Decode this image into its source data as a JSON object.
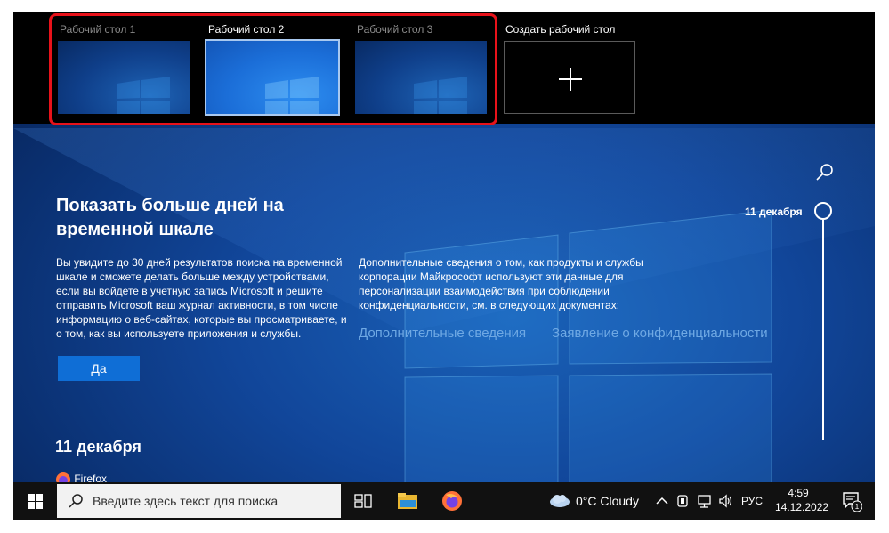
{
  "desktops": [
    {
      "label": "Рабочий стол 1",
      "active": false
    },
    {
      "label": "Рабочий стол 2",
      "active": true
    },
    {
      "label": "Рабочий стол 3",
      "active": false
    }
  ],
  "new_desktop": {
    "label": "Создать рабочий стол",
    "icon": "plus-icon"
  },
  "highlight_color": "#e8121a",
  "timeline": {
    "heading": "Показать больше дней на временной шкале",
    "description": "Вы увидите до 30 дней результатов поиска на временной шкале и сможете делать больше между устройствами, если вы войдете в учетную запись Microsoft и решите отправить Microsoft ваш журнал активности, в том числе информацию о веб-сайтах, которые вы просматриваете, и о том, как вы используете приложения и службы.",
    "privacy_text": "Дополнительные сведения о том, как продукты и службы корпорации Майкрософт используют эти данные для персонализации взаимодействия при соблюдении конфиденциальности, см. в следующих документах:",
    "link_more": "Дополнительные сведения",
    "link_privacy": "Заявление о конфиденциальности",
    "yes_button": "Да",
    "date_heading": "11 декабря",
    "first_item": "Firefox",
    "slider_date": "11 декабря"
  },
  "taskbar": {
    "search_placeholder": "Введите здесь текст для поиска",
    "weather": "0°C  Cloudy",
    "language": "РУС",
    "time": "4:59",
    "date": "14.12.2022",
    "notification_count": "1",
    "icons": [
      "windows-logo-icon",
      "search-icon",
      "task-view-icon",
      "file-explorer-icon",
      "firefox-icon",
      "cloud-icon",
      "chevron-up-icon",
      "meet-now-icon",
      "network-icon",
      "volume-icon",
      "notification-icon"
    ]
  },
  "colors": {
    "accent": "#0f6ed6",
    "link": "#6fa9e4",
    "wallpaper": "#11469a"
  }
}
